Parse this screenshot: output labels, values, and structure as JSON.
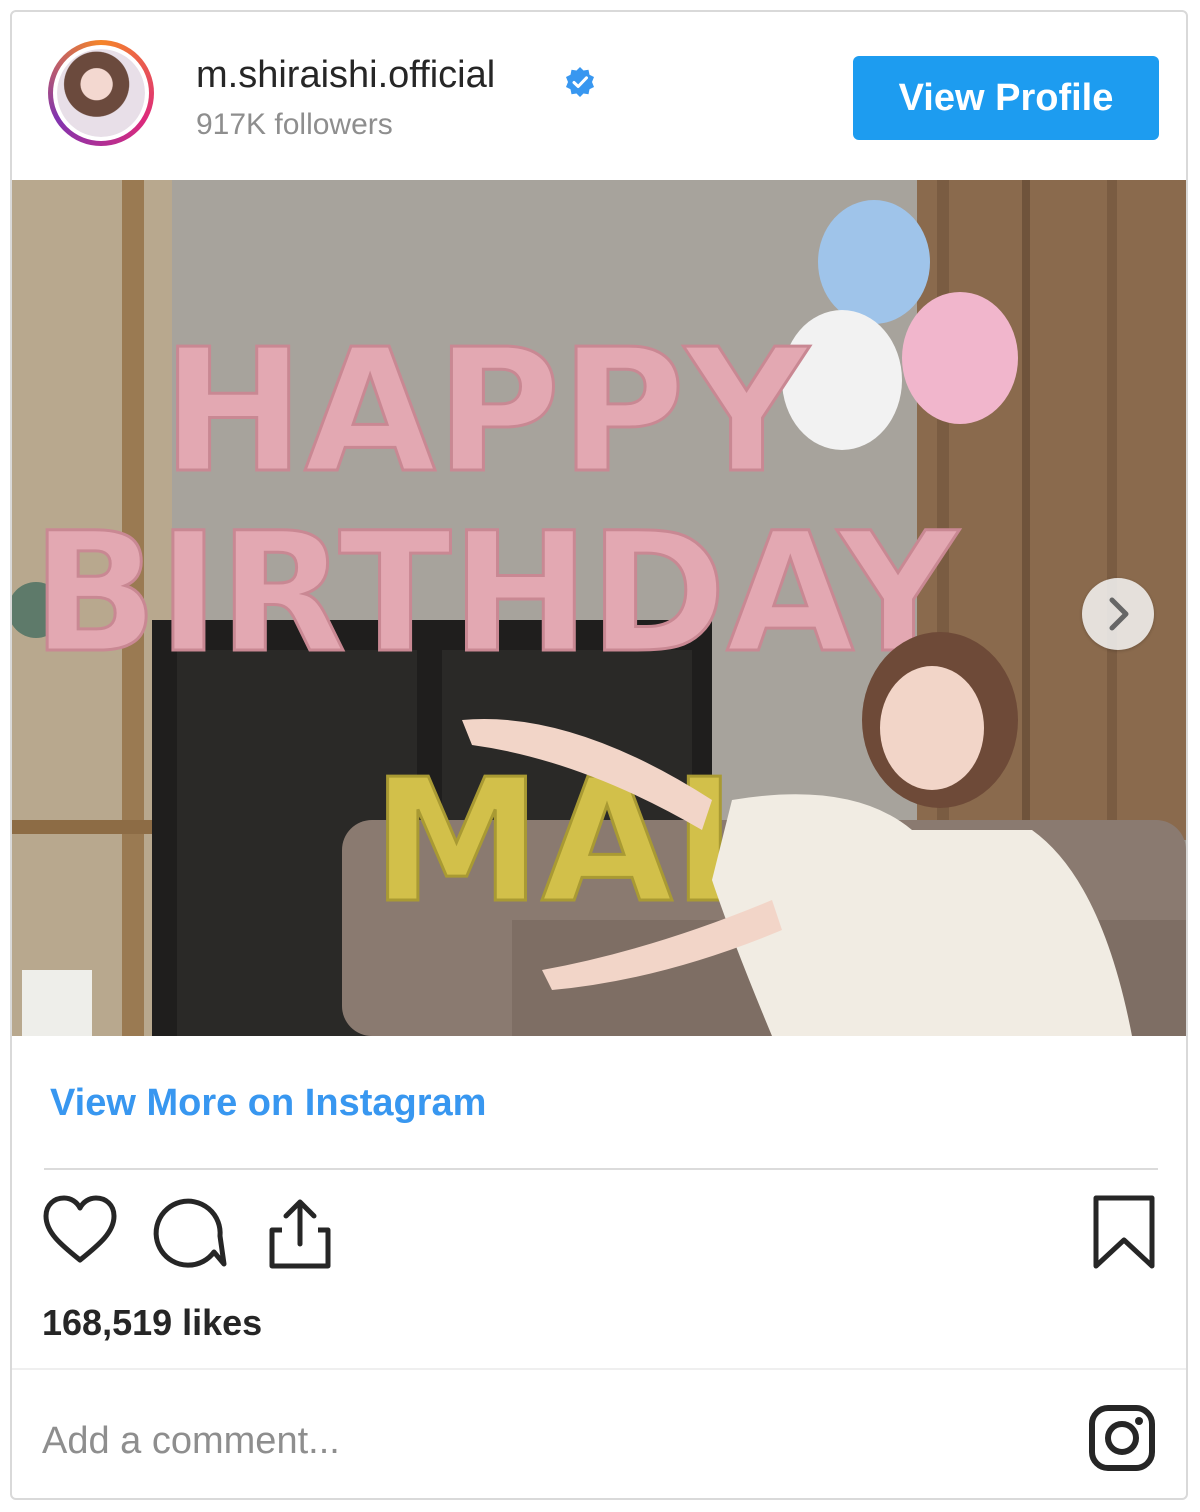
{
  "account": {
    "username": "m.shiraishi.official",
    "followers": "917K followers",
    "verified_icon": "verified-badge-icon"
  },
  "buttons": {
    "view_profile": "View Profile"
  },
  "post": {
    "balloon_text_line1": "HAPPY",
    "balloon_text_line2": "BIRTHDAY",
    "balloon_text_line3": "MAI",
    "carousel_next_icon": "chevron-right-icon"
  },
  "links": {
    "view_more": "View More on Instagram"
  },
  "actions": {
    "like_icon": "heart-icon",
    "comment_icon": "comment-icon",
    "share_icon": "share-icon",
    "save_icon": "bookmark-icon"
  },
  "likes": "168,519 likes",
  "comment": {
    "placeholder": "Add a comment..."
  },
  "brand": {
    "icon": "instagram-icon",
    "accent": "#1d9cf0",
    "link_color": "#3897f0"
  }
}
